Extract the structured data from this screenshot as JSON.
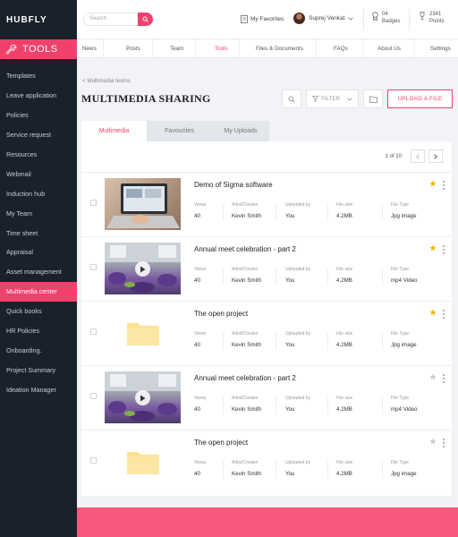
{
  "brand": "HUBFLY",
  "sidebar": {
    "section_title": "TOOLS",
    "items": [
      {
        "label": "Templates"
      },
      {
        "label": "Leave application"
      },
      {
        "label": "Policies"
      },
      {
        "label": "Service request"
      },
      {
        "label": "Resources"
      },
      {
        "label": "Webmail"
      },
      {
        "label": "Induction hub"
      },
      {
        "label": "My Team"
      },
      {
        "label": "Time sheet"
      },
      {
        "label": "Appraisal"
      },
      {
        "label": "Asset management"
      },
      {
        "label": "Multimedia center",
        "active": true
      },
      {
        "label": "Quick books"
      },
      {
        "label": "HR Policies"
      },
      {
        "label": "Onboarding."
      },
      {
        "label": "Project Summary"
      },
      {
        "label": "Ideation Manager"
      }
    ]
  },
  "topbar": {
    "search_placeholder": "Search",
    "favorites_label": "My Favorites",
    "user_name": "Suprej Venkat",
    "badges_count": "04",
    "badges_label": "Badges",
    "points_count": "2341",
    "points_label": "Points"
  },
  "nav": [
    "News",
    "Posts",
    "Team",
    "Tools",
    "Files & Documents",
    "FAQs",
    "About Us",
    "Settings"
  ],
  "nav_active": "Tools",
  "breadcrumb": "< Multimedia teams",
  "page_title": "MULTIMEDIA SHARING",
  "toolbar": {
    "filter_label": "FILTER",
    "upload_label": "UPLOAD A FILE"
  },
  "tabs": [
    "Multimedia",
    "Favourites",
    "My Uploads"
  ],
  "pagination": "1 of 10",
  "meta_labels": {
    "views": "Views",
    "artist": "Artist/Creator",
    "uploaded_by": "Uploaded by",
    "file_size": "File size",
    "file_type": "File Type"
  },
  "items": [
    {
      "title": "Demo of Sigma software",
      "thumb": "photo",
      "views": "40",
      "artist": "Kevin Smith",
      "uploaded_by": "You",
      "file_size": "4.2MB",
      "file_type": "Jpg image",
      "starred": true
    },
    {
      "title": "Annual meet celebration - part 2",
      "thumb": "video",
      "views": "40",
      "artist": "Kevin Smith",
      "uploaded_by": "You",
      "file_size": "4.2MB",
      "file_type": "mp4 Video",
      "starred": true
    },
    {
      "title": "The open project",
      "thumb": "folder",
      "views": "40",
      "artist": "Kevin Smith",
      "uploaded_by": "You",
      "file_size": "4.2MB",
      "file_type": "Jpg image",
      "starred": true
    },
    {
      "title": "Annual meet celebration - part 2",
      "thumb": "video",
      "views": "40",
      "artist": "Kevin Smith",
      "uploaded_by": "You",
      "file_size": "4.2MB",
      "file_type": "mp4 Video",
      "starred": false
    },
    {
      "title": "The open project",
      "thumb": "folder",
      "views": "40",
      "artist": "Kevin Smith",
      "uploaded_by": "You",
      "file_size": "4.2MB",
      "file_type": "Jpg image",
      "starred": false
    }
  ],
  "colors": {
    "accent": "#f0416c",
    "sidebar_bg": "#19212b",
    "star_on": "#f5b800",
    "star_off": "#cccccc"
  }
}
